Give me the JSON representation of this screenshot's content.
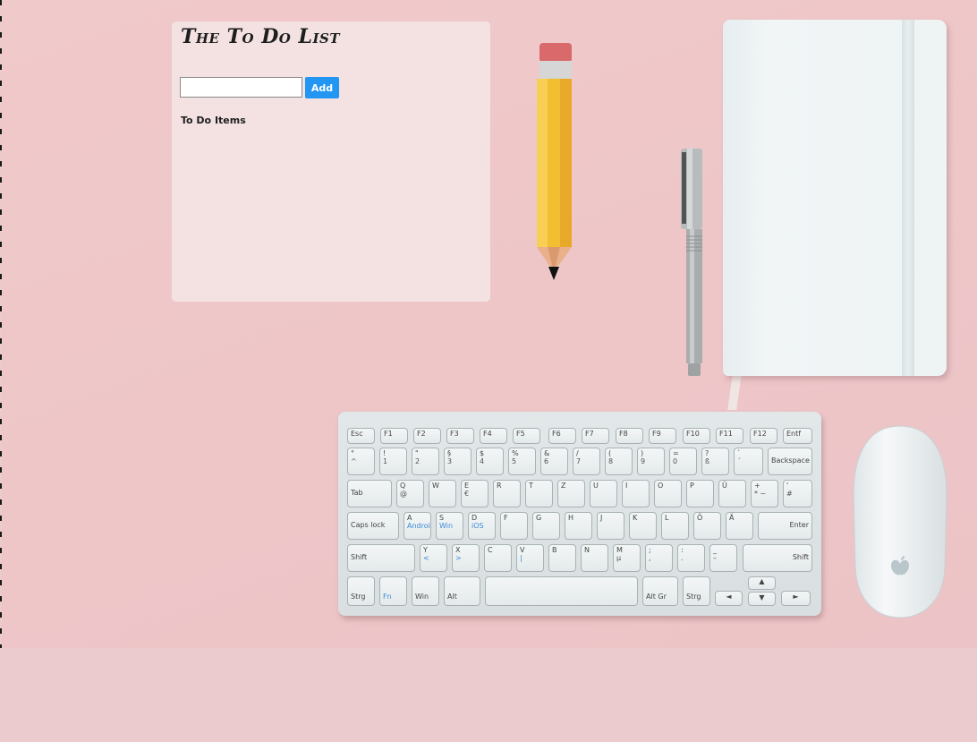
{
  "app": {
    "title": "The To Do List"
  },
  "form": {
    "input_value": "",
    "input_placeholder": "",
    "add_label": "Add"
  },
  "list": {
    "heading": "To Do Items",
    "items": []
  },
  "colors": {
    "background": "#ebcbcd",
    "panel": "#f5e6e8",
    "accent_button": "#2196f3",
    "text": "#1e1e1e"
  },
  "keyboard": {
    "row0": [
      "Esc",
      "F1",
      "F2",
      "F3",
      "F4",
      "F5",
      "F6",
      "F7",
      "F8",
      "F9",
      "F10",
      "F11",
      "F12",
      "Entf"
    ],
    "row1": [
      "^",
      "1",
      "2",
      "3",
      "4",
      "5",
      "6",
      "7",
      "8",
      "9",
      "0",
      "ß",
      "´",
      "Backspace"
    ],
    "row1_shift": [
      "°",
      "!",
      "\"",
      "§",
      "$",
      "%",
      "&",
      "/",
      "(",
      ")",
      "=",
      "?",
      "`",
      ""
    ],
    "row2": [
      "Tab",
      "Q",
      "W",
      "E",
      "R",
      "T",
      "Z",
      "U",
      "I",
      "O",
      "P",
      "Ü",
      "+",
      "'"
    ],
    "row2_sub": [
      "",
      "@",
      "",
      "€",
      "",
      "",
      "",
      "",
      "",
      "",
      "",
      "",
      "*  ~",
      "#"
    ],
    "row3": [
      "Caps lock",
      "A",
      "S",
      "D",
      "F",
      "G",
      "H",
      "J",
      "K",
      "L",
      "Ö",
      "Ä",
      "Enter"
    ],
    "row3_sub": [
      "",
      "Android",
      "Win",
      "iOS",
      "",
      "",
      "",
      "",
      "",
      "",
      "",
      "",
      ""
    ],
    "row4": [
      "Shift",
      "Y",
      "X",
      "C",
      "V",
      "B",
      "N",
      "M",
      ";",
      ":",
      "_",
      "Shift"
    ],
    "row4_sub": [
      "",
      "<",
      ">",
      "",
      "|",
      "",
      "",
      "µ",
      ",",
      ".",
      "–",
      ""
    ],
    "row5": [
      "Strg",
      "Fn",
      "Win",
      "Alt",
      "",
      "Alt Gr",
      "Strg",
      "◄",
      "▲",
      "▼",
      "►"
    ]
  }
}
